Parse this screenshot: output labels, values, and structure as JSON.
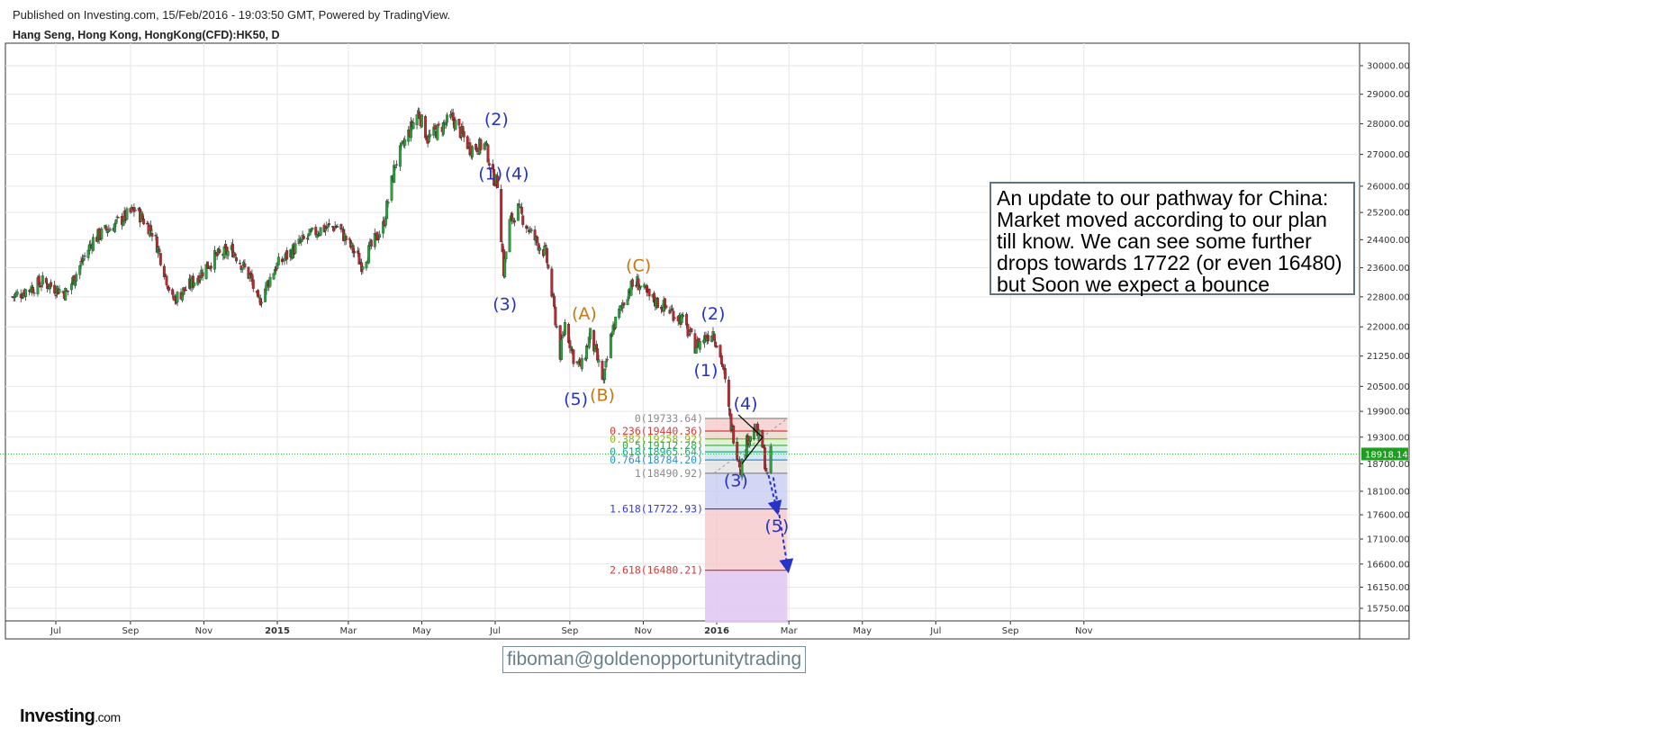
{
  "header": {
    "published_line": "Published on Investing.com, 15/Feb/2016 - 19:03:50 GMT, Powered by TradingView.",
    "symbol_line": "Hang Seng, Hong Kong, HongKong(CFD):HK50, D"
  },
  "note": "An update to our pathway for China: Market moved according to our plan till know. We can see some further drops towards 17722 (or even 16480) but Soon we expect a bounce",
  "signature": "fiboman@goldenopportunitytrading",
  "logo": {
    "main": "Investing",
    "suffix": ".com"
  },
  "colors": {
    "up": "#26a63a",
    "down": "#c0262e",
    "wave_blue": "#2732c8",
    "wave_orange": "#c87612",
    "price_line": "#2ec22e",
    "fib_zone": "#ff8080"
  },
  "chart_data": {
    "type": "candlestick",
    "y_axis": {
      "ticks": [
        30000,
        29000,
        28000,
        27000,
        26000,
        25200,
        24400,
        23600,
        22800,
        22000,
        21250,
        20500,
        19900,
        19300,
        18700,
        18100,
        17600,
        17100,
        16600,
        16150,
        15750
      ],
      "tick_labels": [
        "30000.00",
        "29000.00",
        "28000.00",
        "27000.00",
        "26000.00",
        "25200.00",
        "24400.00",
        "23600.00",
        "22800.00",
        "22000.00",
        "21250.00",
        "20500.00",
        "19900.00",
        "19300.00",
        "18700.00",
        "18100.00",
        "17600.00",
        "17100.00",
        "16600.00",
        "16150.00",
        "15750.00"
      ],
      "scale": "log",
      "range": [
        15500,
        30500
      ]
    },
    "x_axis": {
      "ticks": [
        "2014-07-01",
        "2014-09-01",
        "2014-11-01",
        "2015-01-01",
        "2015-03-01",
        "2015-05-01",
        "2015-07-01",
        "2015-09-01",
        "2015-11-01",
        "2016-01-01",
        "2016-03-01",
        "2016-05-01",
        "2016-07-01",
        "2016-09-01",
        "2016-11-01"
      ],
      "tick_labels": [
        "Jul",
        "Sep",
        "Nov",
        "2015",
        "Mar",
        "May",
        "Jul",
        "Sep",
        "Nov",
        "2016",
        "Mar",
        "May",
        "Jul",
        "Sep",
        "Nov"
      ],
      "range": [
        "2014-05-26",
        "2016-12-31"
      ]
    },
    "current_price": {
      "value": 18918.14,
      "label": "18918.14"
    },
    "price_path": [
      [
        "2014-05-26",
        22800
      ],
      [
        "2014-06-20",
        23200
      ],
      [
        "2014-07-10",
        22900
      ],
      [
        "2014-08-01",
        24400
      ],
      [
        "2014-08-25",
        25000
      ],
      [
        "2014-09-05",
        25300
      ],
      [
        "2014-09-20",
        24600
      ],
      [
        "2014-10-06",
        22700
      ],
      [
        "2014-10-20",
        23100
      ],
      [
        "2014-11-10",
        23900
      ],
      [
        "2014-11-25",
        24100
      ],
      [
        "2014-12-10",
        23300
      ],
      [
        "2014-12-16",
        22600
      ],
      [
        "2014-12-30",
        23600
      ],
      [
        "2015-01-20",
        24300
      ],
      [
        "2015-02-05",
        24700
      ],
      [
        "2015-02-20",
        24800
      ],
      [
        "2015-03-12",
        23700
      ],
      [
        "2015-03-30",
        24800
      ],
      [
        "2015-04-09",
        26700
      ],
      [
        "2015-04-28",
        28400
      ],
      [
        "2015-05-06",
        27500
      ],
      [
        "2015-05-26",
        28200
      ],
      [
        "2015-06-10",
        27200
      ],
      [
        "2015-06-23",
        27300
      ],
      [
        "2015-06-29",
        26300
      ],
      [
        "2015-07-03",
        26100
      ],
      [
        "2015-07-08",
        23500
      ],
      [
        "2015-07-13",
        24900
      ],
      [
        "2015-07-20",
        25300
      ],
      [
        "2015-08-01",
        24500
      ],
      [
        "2015-08-12",
        24000
      ],
      [
        "2015-08-24",
        21300
      ],
      [
        "2015-08-28",
        22100
      ],
      [
        "2015-09-05",
        21100
      ],
      [
        "2015-09-11",
        21000
      ],
      [
        "2015-09-18",
        21800
      ],
      [
        "2015-09-29",
        20600
      ],
      [
        "2015-10-06",
        21900
      ],
      [
        "2015-10-20",
        23000
      ],
      [
        "2015-10-27",
        23200
      ],
      [
        "2015-11-05",
        22800
      ],
      [
        "2015-11-20",
        22500
      ],
      [
        "2015-12-03",
        22200
      ],
      [
        "2015-12-14",
        21500
      ],
      [
        "2015-12-29",
        21900
      ],
      [
        "2016-01-06",
        21000
      ],
      [
        "2016-01-12",
        19700
      ],
      [
        "2016-01-21",
        18600
      ],
      [
        "2016-01-27",
        19300
      ],
      [
        "2016-02-02",
        19500
      ],
      [
        "2016-02-08",
        19100
      ],
      [
        "2016-02-12",
        18400
      ],
      [
        "2016-02-15",
        18918
      ]
    ],
    "waves": [
      {
        "label": "(1)",
        "date": "2015-06-27",
        "price": 26200,
        "color": "blue"
      },
      {
        "label": "(2)",
        "date": "2015-07-02",
        "price": 27950,
        "color": "blue"
      },
      {
        "label": "(3)",
        "date": "2015-07-09",
        "price": 22450,
        "color": "blue"
      },
      {
        "label": "(4)",
        "date": "2015-07-19",
        "price": 26200,
        "color": "blue"
      },
      {
        "label": "(5)",
        "date": "2015-09-06",
        "price": 20050,
        "color": "blue"
      },
      {
        "label": "(A)",
        "date": "2015-09-13",
        "price": 22200,
        "color": "orange"
      },
      {
        "label": "(B)",
        "date": "2015-09-28",
        "price": 20150,
        "color": "orange"
      },
      {
        "label": "(C)",
        "date": "2015-10-28",
        "price": 23500,
        "color": "orange"
      },
      {
        "label": "(2)",
        "date": "2015-12-29",
        "price": 22200,
        "color": "blue"
      },
      {
        "label": "(1)",
        "date": "2015-12-23",
        "price": 20750,
        "color": "blue"
      },
      {
        "label": "(4)",
        "date": "2016-01-25",
        "price": 19950,
        "color": "blue"
      },
      {
        "label": "(3)",
        "date": "2016-01-17",
        "price": 18200,
        "color": "blue"
      },
      {
        "label": "(5)",
        "date": "2016-02-20",
        "price": 17250,
        "color": "blue"
      }
    ],
    "fibonacci": {
      "start_date": "2016-01-01",
      "end_date": "2016-02-25",
      "levels": [
        {
          "ratio": "0",
          "value": 19733.64,
          "label": "0(19733.64)",
          "color": "#8a8a8a"
        },
        {
          "ratio": "0.236",
          "value": 19440.36,
          "label": "0.236(19440.36)",
          "color": "#d43a3a"
        },
        {
          "ratio": "0.382",
          "value": 19258.92,
          "label": "0.382(19258.92)",
          "color": "#8ab820"
        },
        {
          "ratio": "0.5",
          "value": 19112.28,
          "label": "0.5(19112.28)",
          "color": "#39a84a"
        },
        {
          "ratio": "0.618",
          "value": 18965.64,
          "label": "0.618(18965.64)",
          "color": "#1fa88a"
        },
        {
          "ratio": "0.764",
          "value": 18784.2,
          "label": "0.764(18784.20)",
          "color": "#2f8fd0"
        },
        {
          "ratio": "1",
          "value": 18490.92,
          "label": "1(18490.92)",
          "color": "#8a8a8a"
        },
        {
          "ratio": "1.618",
          "value": 17722.93,
          "label": "1.618(17722.93)",
          "color": "#3a3ad0"
        },
        {
          "ratio": "2.618",
          "value": 16480.21,
          "label": "2.618(16480.21)",
          "color": "#d43a3a"
        }
      ]
    }
  }
}
